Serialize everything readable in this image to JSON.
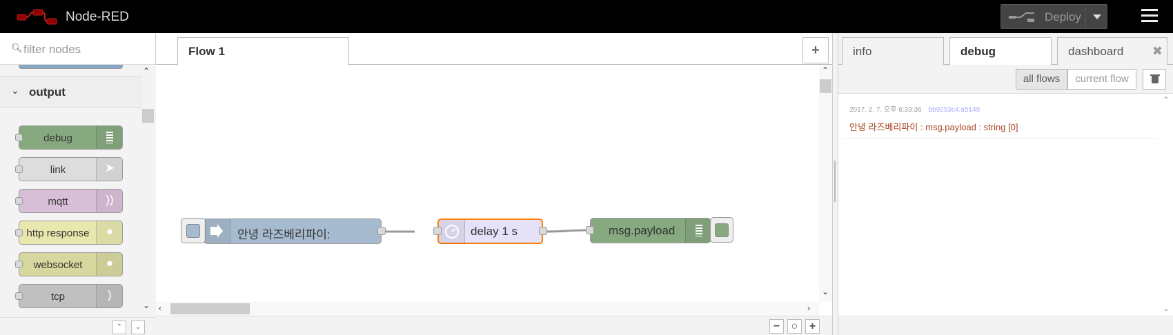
{
  "header": {
    "app_title": "Node-RED",
    "deploy_label": "Deploy"
  },
  "palette": {
    "search_placeholder": "filter nodes",
    "category": "output",
    "nodes": [
      {
        "label": "debug",
        "color": "#87a980",
        "icon": "list-icon"
      },
      {
        "label": "link",
        "color": "#dddddd",
        "icon": "link-out-icon"
      },
      {
        "label": "mqtt",
        "color": "#d8bfd8",
        "icon": "mqtt-icon"
      },
      {
        "label": "http response",
        "color": "#e7e7ae",
        "icon": "globe-icon"
      },
      {
        "label": "websocket",
        "color": "#d7d7a0",
        "icon": "globe-icon"
      },
      {
        "label": "tcp",
        "color": "#c0c0c0",
        "icon": "bridge-icon"
      }
    ]
  },
  "workspace": {
    "tab_label": "Flow 1",
    "nodes": [
      {
        "label": "안녕 라즈베리파이:",
        "type": "inject",
        "color": "#a6bbcf"
      },
      {
        "label": "delay 1 s",
        "type": "delay",
        "color": "#e6e0f8",
        "selected_color": "#ff7f0e"
      },
      {
        "label": "msg.payload",
        "type": "debug",
        "color": "#87a980"
      }
    ]
  },
  "sidebar": {
    "tabs": [
      "info",
      "debug",
      "dashboard"
    ],
    "active_tab": "debug",
    "filter_all": "all flows",
    "filter_current": "current flow",
    "messages": [
      {
        "timestamp": "2017. 2. 7. 오후 6:33:36",
        "node_id": "bb9253c4.a5149",
        "payload": "안녕 라즈베리파이 : msg.payload : string [0]"
      }
    ]
  }
}
